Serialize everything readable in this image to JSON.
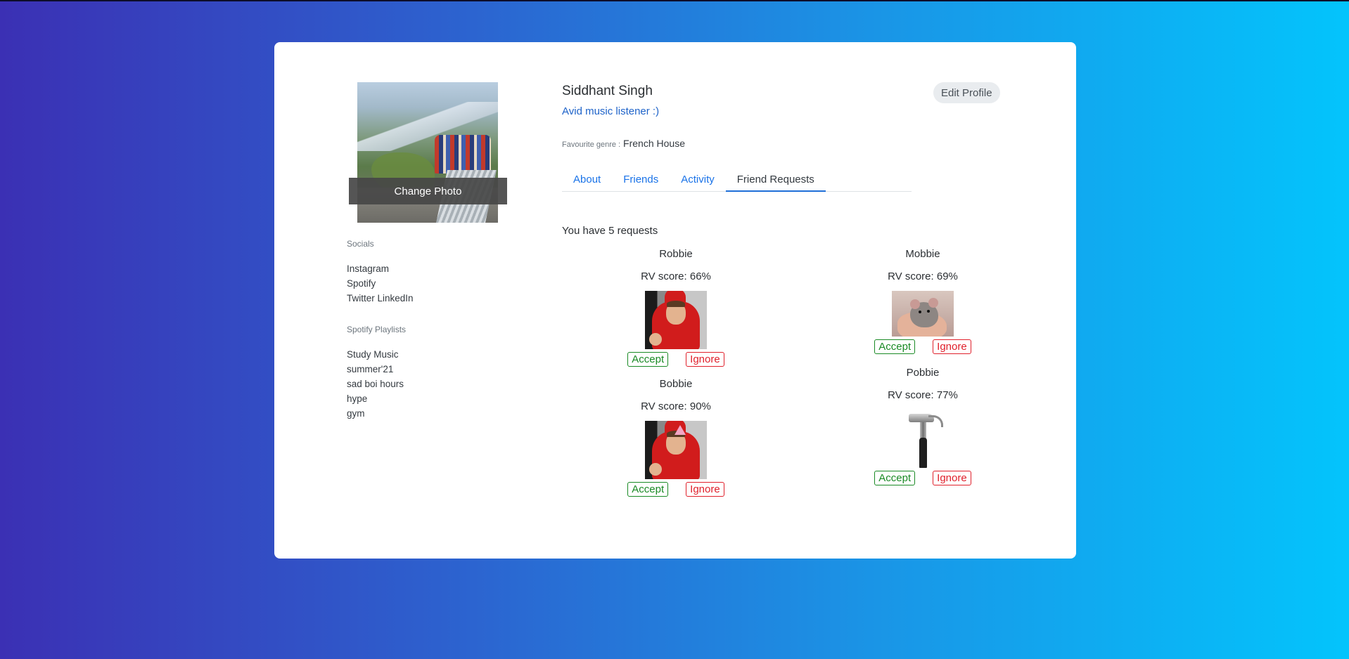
{
  "profile": {
    "name": "Siddhant Singh",
    "tagline": "Avid music listener :)",
    "genre_label": "Favourite genre :",
    "genre_value": "French House",
    "change_photo_label": "Change Photo",
    "edit_profile_label": "Edit Profile"
  },
  "sidebar": {
    "socials_heading": "Socials",
    "socials": [
      "Instagram",
      "Spotify",
      "Twitter LinkedIn"
    ],
    "playlists_heading": "Spotify Playlists",
    "playlists": [
      "Study Music",
      "summer'21",
      "sad boi hours",
      "hype",
      "gym"
    ]
  },
  "tabs": [
    {
      "label": "About"
    },
    {
      "label": "Friends"
    },
    {
      "label": "Activity"
    },
    {
      "label": "Friend Requests",
      "active": true
    }
  ],
  "requests": {
    "count_text": "You have 5 requests",
    "accept_label": "Accept",
    "ignore_label": "Ignore",
    "items": [
      {
        "name": "Robbie",
        "score": "RV score: 66%",
        "picture": "kid-in-red-costume"
      },
      {
        "name": "Mobbie",
        "score": "RV score: 69%",
        "picture": "mouse-in-hand"
      },
      {
        "name": "Bobbie",
        "score": "RV score: 90%",
        "picture": "kid-in-red-costume-party-hat"
      },
      {
        "name": "Pobbie",
        "score": "RV score: 77%",
        "picture": "hammer"
      }
    ]
  },
  "colors": {
    "accent": "#1a73e8",
    "accept": "#1a8a25",
    "ignore": "#e0202b"
  }
}
